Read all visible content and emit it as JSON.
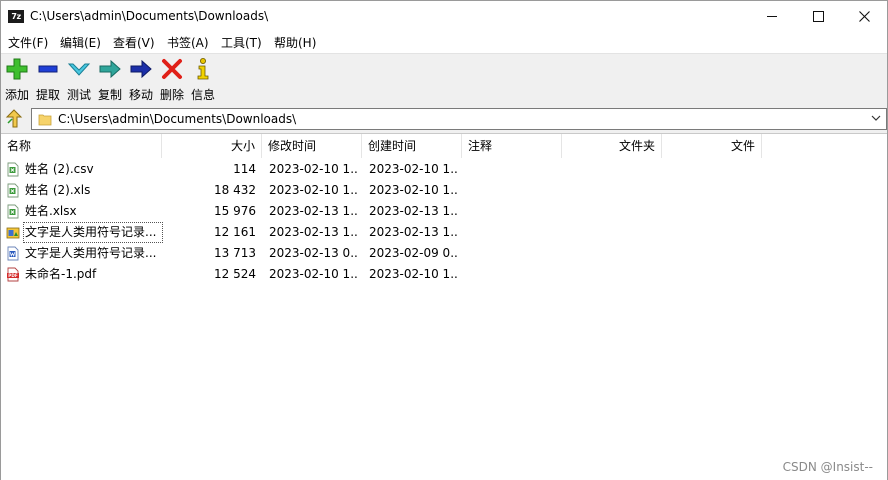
{
  "window": {
    "title": "C:\\Users\\admin\\Documents\\Downloads\\",
    "app_icon_text": "7z"
  },
  "menu": [
    "文件(F)",
    "编辑(E)",
    "查看(V)",
    "书签(A)",
    "工具(T)",
    "帮助(H)"
  ],
  "toolbar": [
    {
      "label": "添加",
      "icon": "add-icon"
    },
    {
      "label": "提取",
      "icon": "extract-icon"
    },
    {
      "label": "测试",
      "icon": "test-icon"
    },
    {
      "label": "复制",
      "icon": "copy-icon"
    },
    {
      "label": "移动",
      "icon": "move-icon"
    },
    {
      "label": "删除",
      "icon": "delete-icon"
    },
    {
      "label": "信息",
      "icon": "info-icon"
    }
  ],
  "address": {
    "path": "C:\\Users\\admin\\Documents\\Downloads\\"
  },
  "columns": [
    "名称",
    "大小",
    "修改时间",
    "创建时间",
    "注释",
    "文件夹",
    "文件"
  ],
  "files": [
    {
      "name": "姓名 (2).csv",
      "size": "114",
      "modified": "2023-02-10 1...",
      "created": "2023-02-10 1...",
      "icon": "spreadsheet-icon"
    },
    {
      "name": "姓名 (2).xls",
      "size": "18 432",
      "modified": "2023-02-10 1...",
      "created": "2023-02-10 1...",
      "icon": "spreadsheet-icon"
    },
    {
      "name": "姓名.xlsx",
      "size": "15 976",
      "modified": "2023-02-13 1...",
      "created": "2023-02-13 1...",
      "icon": "spreadsheet-icon"
    },
    {
      "name": "文字是人类用符号记录...",
      "size": "12 161",
      "modified": "2023-02-13 1...",
      "created": "2023-02-13 1...",
      "icon": "image-file-icon"
    },
    {
      "name": "文字是人类用符号记录...",
      "size": "13 713",
      "modified": "2023-02-13 0...",
      "created": "2023-02-09 0...",
      "icon": "word-doc-icon"
    },
    {
      "name": "未命名-1.pdf",
      "size": "12 524",
      "modified": "2023-02-10 1...",
      "created": "2023-02-10 1...",
      "icon": "pdf-icon"
    }
  ],
  "watermark": "CSDN @Insist--"
}
